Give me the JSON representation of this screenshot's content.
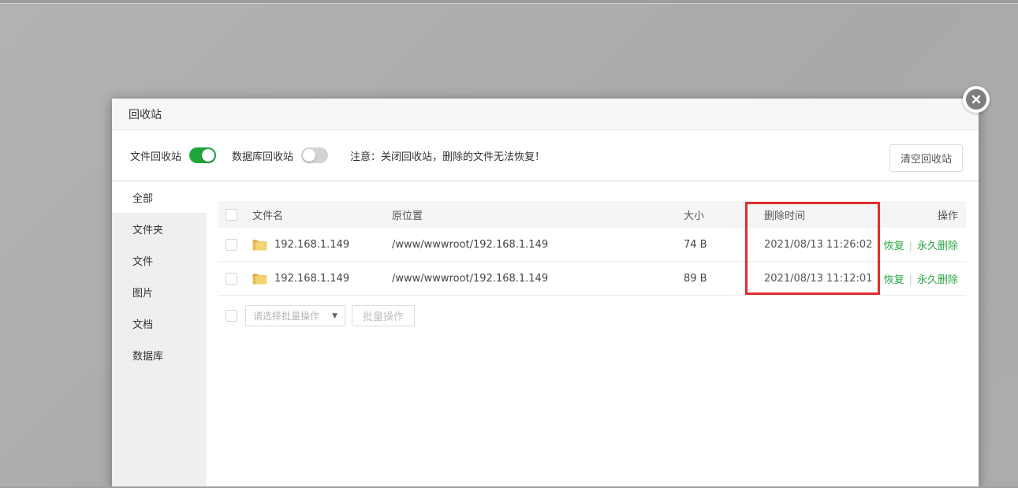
{
  "dialog": {
    "title": "回收站"
  },
  "toolbar": {
    "file_toggle_label": "文件回收站",
    "file_toggle_state": "on",
    "db_toggle_label": "数据库回收站",
    "db_toggle_state": "off",
    "notice": "注意：关闭回收站，删除的文件无法恢复！",
    "clear_button": "清空回收站"
  },
  "sidebar": {
    "items": [
      {
        "label": "全部",
        "selected": true
      },
      {
        "label": "文件夹",
        "selected": false
      },
      {
        "label": "文件",
        "selected": false
      },
      {
        "label": "图片",
        "selected": false
      },
      {
        "label": "文档",
        "selected": false
      },
      {
        "label": "数据库",
        "selected": false
      }
    ]
  },
  "table": {
    "headers": {
      "name": "文件名",
      "path": "原位置",
      "size": "大小",
      "time": "删除时间",
      "action": "操作"
    },
    "rows": [
      {
        "name": "192.168.1.149",
        "path": "/www/wwwroot/192.168.1.149",
        "size": "74 B",
        "time": "2021/08/13 11:26:02",
        "restore": "恢复",
        "delete": "永久删除"
      },
      {
        "name": "192.168.1.149",
        "path": "/www/wwwroot/192.168.1.149",
        "size": "89 B",
        "time": "2021/08/13 11:12:01",
        "restore": "恢复",
        "delete": "永久删除"
      }
    ],
    "action_separator": "|"
  },
  "batch": {
    "select_placeholder": "请选择批量操作",
    "button": "批量操作"
  },
  "annotation": {
    "highlighted_column": "删除时间",
    "box_color": "#e12d2d"
  },
  "colors": {
    "green": "#20a53a",
    "link_green": "#27a744",
    "red": "#e12d2d"
  }
}
